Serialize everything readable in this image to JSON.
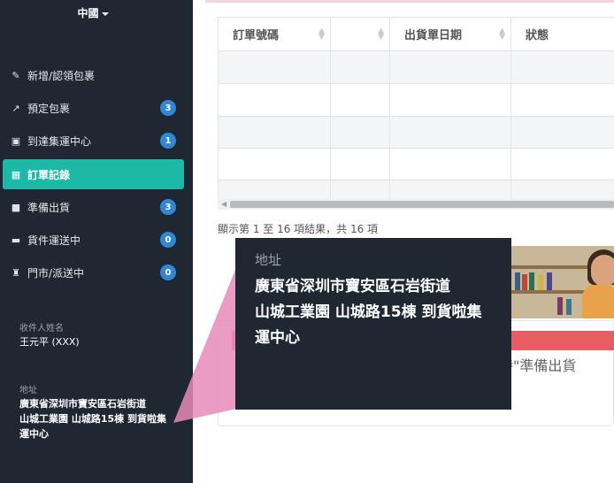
{
  "sidebar": {
    "region": "中國",
    "items": [
      {
        "label": "新增/認領包裹",
        "icon": "edit-icon",
        "badge": ""
      },
      {
        "label": "預定包裹",
        "icon": "external-link-icon",
        "badge": "3"
      },
      {
        "label": "到達集運中心",
        "icon": "money-icon",
        "badge": "1"
      },
      {
        "label": "訂單記錄",
        "icon": "calendar-icon",
        "badge": "",
        "active": true
      },
      {
        "label": "準備出貨",
        "icon": "gift-icon",
        "badge": "3"
      },
      {
        "label": "貨件運送中",
        "icon": "truck-icon",
        "badge": "0"
      },
      {
        "label": "門市/派送中",
        "icon": "trophy-icon",
        "badge": "0"
      }
    ],
    "recipient_label": "收件人姓名",
    "recipient_value": "王元平 (XXX)",
    "address_label": "地址",
    "address_value": "廣東省深圳市寶安區石岩街道\n山城工業園 山城路15棟 到貨啦集運中心"
  },
  "table": {
    "columns": [
      {
        "label": "訂單號碼"
      },
      {
        "label": ""
      },
      {
        "label": "出貨單日期"
      },
      {
        "label": "狀態"
      }
    ],
    "summary": "顯示第 1 至 16 項結果，共 16 項"
  },
  "notice": {
    "text": "現時\"準備出貨"
  },
  "callout": {
    "label": "地址",
    "line1": "廣東省深圳市寶安區石岩街道",
    "line2": "山城工業園 山城路15棟 到貨啦集運中心"
  },
  "colors": {
    "sidebar_bg": "#1f2733",
    "active_teal": "#1eb8a6",
    "badge_blue": "#2f87d6",
    "callout_pink": "#e88bbb",
    "notice_red": "#e85d61"
  }
}
